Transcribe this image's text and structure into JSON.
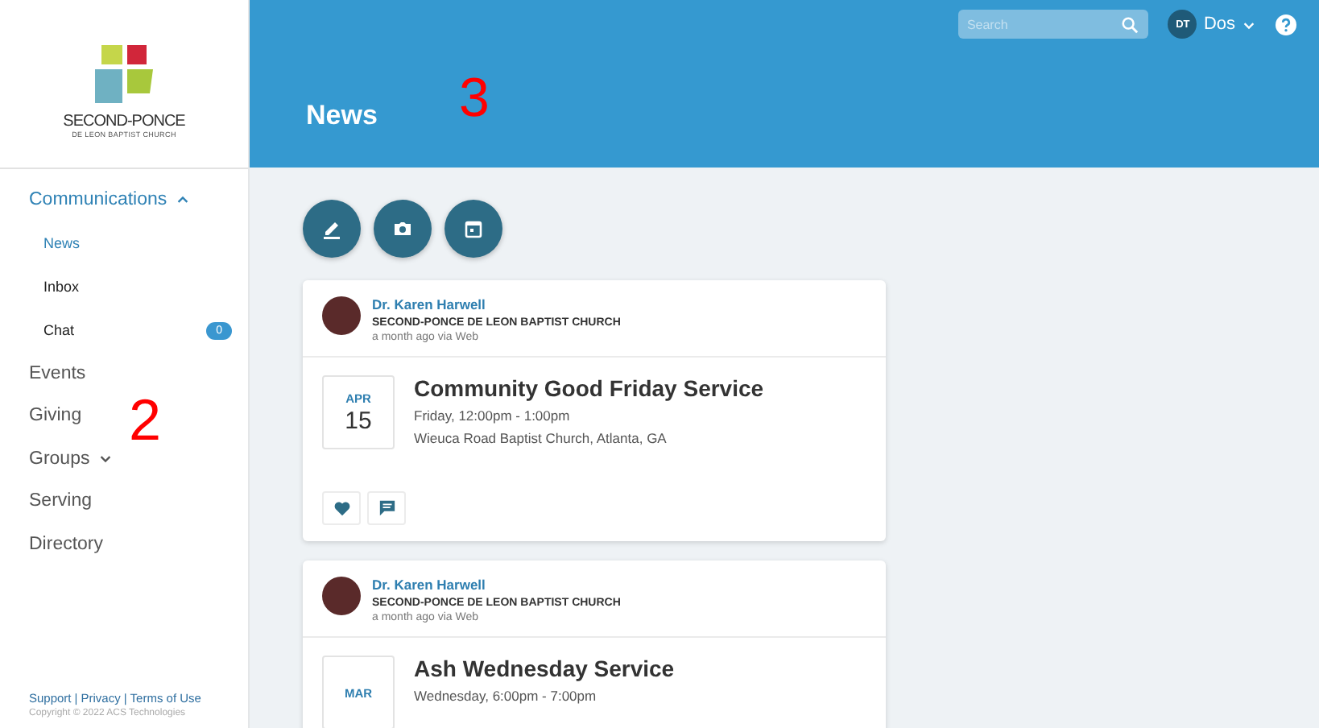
{
  "sidebar": {
    "logo": {
      "name": "SECOND-PONCE",
      "subtitle": "DE LEON BAPTIST CHURCH"
    },
    "items": [
      {
        "label": "Communications",
        "kind": "group",
        "expanded": true,
        "children": [
          {
            "label": "News",
            "selected": true
          },
          {
            "label": "Inbox",
            "selected": false
          },
          {
            "label": "Chat",
            "selected": false,
            "badge": "0"
          }
        ]
      },
      {
        "label": "Events",
        "kind": "link"
      },
      {
        "label": "Giving",
        "kind": "link"
      },
      {
        "label": "Groups",
        "kind": "group",
        "expanded": false
      },
      {
        "label": "Serving",
        "kind": "link"
      },
      {
        "label": "Directory",
        "kind": "link"
      }
    ],
    "annotation": "2",
    "footer": {
      "separator": "|",
      "links": [
        "Support",
        "Privacy",
        "Terms of Use"
      ],
      "copyright": "Copyright © 2022 ACS Technologies"
    }
  },
  "header": {
    "search": {
      "placeholder": "Search"
    },
    "user": {
      "initials": "DT",
      "name": "Dos"
    },
    "title": "News",
    "annotation": "3"
  },
  "actions": [
    {
      "kind": "post"
    },
    {
      "kind": "photo"
    },
    {
      "kind": "event"
    }
  ],
  "posts": [
    {
      "author": "Dr. Karen Harwell",
      "org": "SECOND-PONCE DE LEON BAPTIST CHURCH",
      "meta": "a month ago via Web",
      "event": {
        "month": "APR",
        "day": "15",
        "title": "Community Good Friday Service",
        "when": "Friday, 12:00pm - 1:00pm",
        "where": "Wieuca Road Baptist Church, Atlanta, GA"
      },
      "reactions": [
        {
          "kind": "like"
        },
        {
          "kind": "comment"
        }
      ]
    },
    {
      "author": "Dr. Karen Harwell",
      "org": "SECOND-PONCE DE LEON BAPTIST CHURCH",
      "meta": "a month ago via Web",
      "event": {
        "month": "MAR",
        "title": "Ash Wednesday Service",
        "when": "Wednesday, 6:00pm - 7:00pm"
      }
    }
  ]
}
